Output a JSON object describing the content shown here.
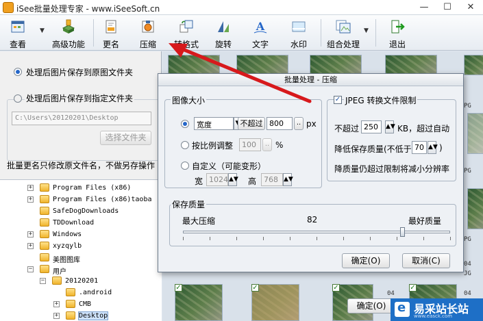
{
  "window": {
    "title": "iSee批量处理专家 - www.iSeeSoft.cn",
    "min": "—",
    "max": "☐",
    "close": "✕"
  },
  "toolbar": [
    {
      "id": "view",
      "label": "查看",
      "icon": "view-icon"
    },
    {
      "id": "advanced",
      "label": "高级功能",
      "icon": "advanced-icon"
    },
    {
      "id": "rename",
      "label": "更名",
      "icon": "rename-icon"
    },
    {
      "id": "compress",
      "label": "压缩",
      "icon": "compress-icon"
    },
    {
      "id": "convert",
      "label": "转格式",
      "icon": "convert-icon"
    },
    {
      "id": "rotate",
      "label": "旋转",
      "icon": "rotate-icon"
    },
    {
      "id": "text",
      "label": "文字",
      "icon": "text-icon"
    },
    {
      "id": "watermark",
      "label": "水印",
      "icon": "watermark-icon"
    },
    {
      "id": "combo",
      "label": "组合处理",
      "icon": "combo-icon"
    },
    {
      "id": "exit",
      "label": "退出",
      "icon": "exit-icon"
    }
  ],
  "left": {
    "save_original": "处理后图片保存到原图文件夹",
    "save_specified": "处理后图片保存到指定文件夹",
    "path": "C:\\Users\\20120201\\Desktop",
    "choose_folder": "选择文件夹",
    "note": "批量更名只修改原文件名，不做另存操作"
  },
  "tree": [
    {
      "label": "Program Files (x86)",
      "level": 1,
      "exp": "+"
    },
    {
      "label": "Program Files (x86)taoba",
      "level": 1,
      "exp": "+"
    },
    {
      "label": "SafeDogDownloads",
      "level": 1,
      "exp": ""
    },
    {
      "label": "TDDownload",
      "level": 1,
      "exp": ""
    },
    {
      "label": "Windows",
      "level": 1,
      "exp": "+"
    },
    {
      "label": "xyzqylb",
      "level": 1,
      "exp": "+"
    },
    {
      "label": "美图图库",
      "level": 1,
      "exp": ""
    },
    {
      "label": "用户",
      "level": 1,
      "exp": "−"
    },
    {
      "label": "20120201",
      "level": 2,
      "exp": "−"
    },
    {
      "label": ".android",
      "level": 3,
      "exp": ""
    },
    {
      "label": "CMB",
      "level": 3,
      "exp": "+"
    },
    {
      "label": "Desktop",
      "level": 3,
      "exp": "+"
    }
  ],
  "thumbs": {
    "captions": [
      "PG",
      "PG",
      "PG",
      "04",
      "04",
      "JG",
      "04"
    ]
  },
  "dialog": {
    "title": "批量处理 - 压缩",
    "size_group": "图像大小",
    "mode_width": "宽度",
    "not_exceed": "不超过",
    "width_value": "800",
    "dots": "..",
    "unit_px": "px",
    "proportional": "按比例调整",
    "percent_value": "100",
    "unit_pct": "%",
    "custom": "自定义（可能变形）",
    "w_label": "宽",
    "w_value": "1024",
    "h_label": "高",
    "h_value": "768",
    "jpeg_limit": "JPEG 转换文件限制",
    "not_exceed2": "不超过",
    "kb_value": "250",
    "kb_suffix": "KB，超过自动",
    "lower_quality": "降低保存质量(不低于",
    "min_quality": "70",
    "close_paren": ")",
    "still_exceed": "降质量仍超过限制将减小分辨率",
    "quality_group": "保存质量",
    "max_compress": "最大压缩",
    "quality_value": "82",
    "best_quality": "最好质量",
    "quality_fraction": 0.82,
    "ok": "确定(O)",
    "cancel": "取消(C)",
    "ok2": "确定(O)"
  },
  "watermark": {
    "title": "易采站长站",
    "sub": "www.easck.com"
  },
  "colors": {
    "accent": "#2466c8",
    "arrow": "#d7191c",
    "watermark": "#1e6fc6"
  }
}
